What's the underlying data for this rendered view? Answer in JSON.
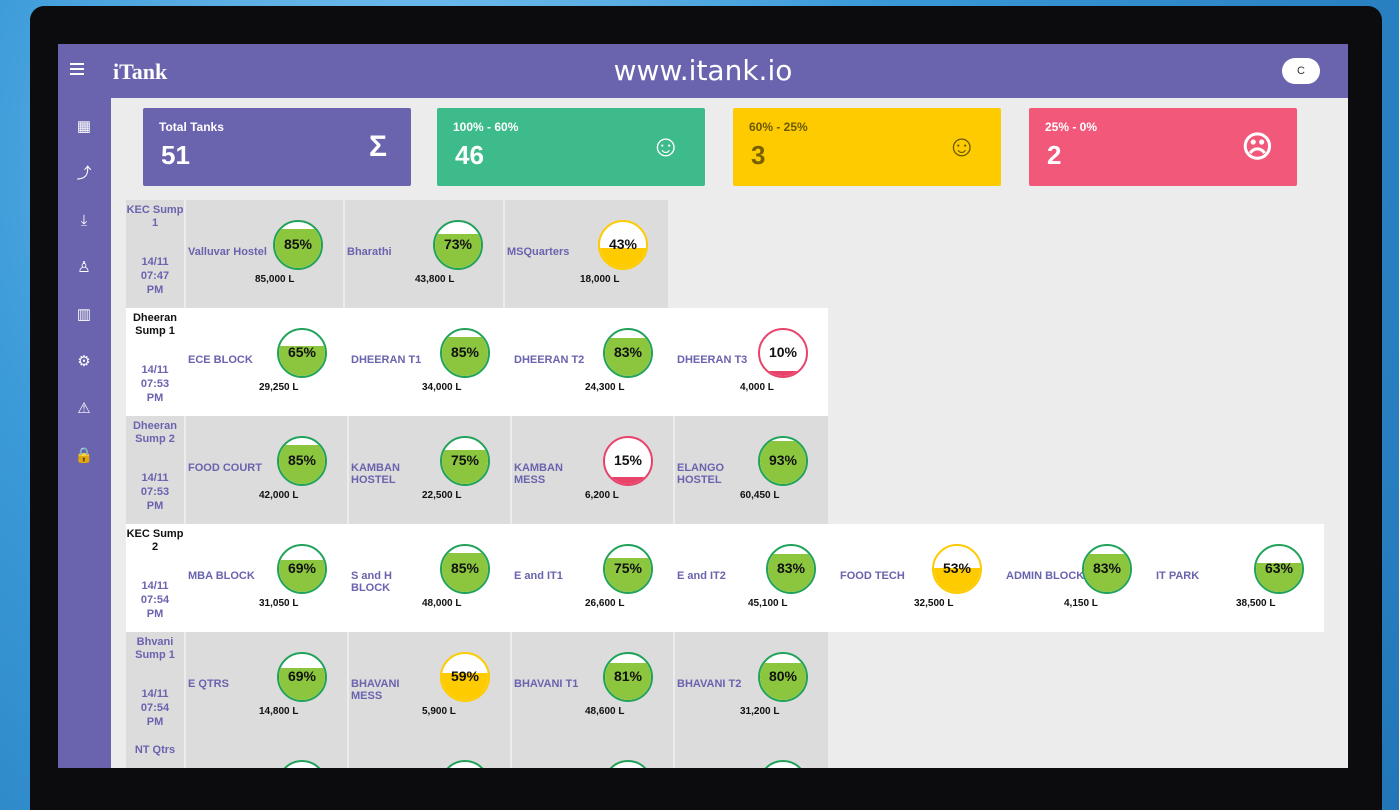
{
  "app": {
    "menu_icon": "hamburger-icon",
    "brand": "iTank",
    "site": "www.itank.io",
    "top_button": "C"
  },
  "sidebar": [
    "dashboard-icon",
    "trend-chart-icon",
    "download-icon",
    "user-icon",
    "map-icon",
    "settings-icon",
    "alert-icon",
    "lock-icon"
  ],
  "summary": {
    "total": {
      "label": "Total Tanks",
      "value": "51",
      "icon": "sigma-icon",
      "glyph": "Σ"
    },
    "high": {
      "label": "100% - 60%",
      "value": "46",
      "icon": "happy-face-icon",
      "glyph": "☺"
    },
    "mid": {
      "label": "60% - 25%",
      "value": "3",
      "icon": "neutral-face-icon",
      "glyph": "☺"
    },
    "low": {
      "label": "25% - 0%",
      "value": "2",
      "icon": "sad-face-icon",
      "glyph": "☹"
    }
  },
  "colors": {
    "green": "#21a25a",
    "green_fill": "#8cc63f",
    "yellow": "#fecb00",
    "red": "#e8436a",
    "purple": "#6a63ae"
  },
  "rows": [
    {
      "sump": "KEC Sump 1",
      "date": "14/11",
      "time": "07:47",
      "ampm": "PM",
      "tanks": [
        {
          "name": "Valluvar Hostel",
          "pct": "85%",
          "level": 0.85,
          "vol": "85,000 L"
        },
        {
          "name": "Bharathi",
          "pct": "73%",
          "level": 0.73,
          "vol": "43,800 L"
        },
        {
          "name": "MSQuarters",
          "pct": "43%",
          "level": 0.43,
          "vol": "18,000 L"
        }
      ]
    },
    {
      "sump": "Dheeran Sump 1",
      "date": "14/11",
      "time": "07:53",
      "ampm": "PM",
      "tanks": [
        {
          "name": "ECE BLOCK",
          "pct": "65%",
          "level": 0.65,
          "vol": "29,250 L"
        },
        {
          "name": "DHEERAN T1",
          "pct": "85%",
          "level": 0.85,
          "vol": "34,000 L"
        },
        {
          "name": "DHEERAN T2",
          "pct": "83%",
          "level": 0.83,
          "vol": "24,300 L"
        },
        {
          "name": "DHEERAN T3",
          "pct": "10%",
          "level": 0.1,
          "vol": "4,000 L"
        }
      ]
    },
    {
      "sump": "Dheeran Sump 2",
      "date": "14/11",
      "time": "07:53",
      "ampm": "PM",
      "tanks": [
        {
          "name": "FOOD COURT",
          "pct": "85%",
          "level": 0.85,
          "vol": "42,000 L"
        },
        {
          "name": "KAMBAN HOSTEL",
          "pct": "75%",
          "level": 0.75,
          "vol": "22,500 L"
        },
        {
          "name": "KAMBAN MESS",
          "pct": "15%",
          "level": 0.15,
          "vol": "6,200 L"
        },
        {
          "name": "ELANGO HOSTEL",
          "pct": "93%",
          "level": 0.93,
          "vol": "60,450 L"
        }
      ]
    },
    {
      "sump": "KEC Sump 2",
      "date": "14/11",
      "time": "07:54",
      "ampm": "PM",
      "tanks": [
        {
          "name": "MBA BLOCK",
          "pct": "69%",
          "level": 0.69,
          "vol": "31,050 L"
        },
        {
          "name": "S and H BLOCK",
          "pct": "85%",
          "level": 0.85,
          "vol": "48,000 L"
        },
        {
          "name": "E and IT1",
          "pct": "75%",
          "level": 0.75,
          "vol": "26,600 L"
        },
        {
          "name": "E and IT2",
          "pct": "83%",
          "level": 0.83,
          "vol": "45,100 L"
        },
        {
          "name": "FOOD TECH",
          "pct": "53%",
          "level": 0.53,
          "vol": "32,500 L"
        },
        {
          "name": "ADMIN BLOCK",
          "pct": "83%",
          "level": 0.83,
          "vol": "4,150 L"
        },
        {
          "name": "IT PARK",
          "pct": "63%",
          "level": 0.63,
          "vol": "38,500 L"
        }
      ]
    },
    {
      "sump": "Bhvani Sump 1",
      "date": "14/11",
      "time": "07:54",
      "ampm": "PM",
      "tanks": [
        {
          "name": "E QTRS",
          "pct": "69%",
          "level": 0.69,
          "vol": "14,800 L"
        },
        {
          "name": "BHAVANI MESS",
          "pct": "59%",
          "level": 0.59,
          "vol": "5,900 L"
        },
        {
          "name": "BHAVANI T1",
          "pct": "81%",
          "level": 0.81,
          "vol": "48,600 L"
        },
        {
          "name": "BHAVANI T2",
          "pct": "80%",
          "level": 0.8,
          "vol": "31,200 L"
        }
      ]
    },
    {
      "sump": "NT Qtrs",
      "date": "",
      "time": "",
      "ampm": "",
      "tanks": [
        {
          "name": "",
          "pct": "",
          "level": 0.8,
          "vol": ""
        },
        {
          "name": "",
          "pct": "",
          "level": 0.8,
          "vol": ""
        },
        {
          "name": "",
          "pct": "",
          "level": 0.8,
          "vol": ""
        },
        {
          "name": "",
          "pct": "",
          "level": 0.8,
          "vol": ""
        }
      ]
    }
  ]
}
